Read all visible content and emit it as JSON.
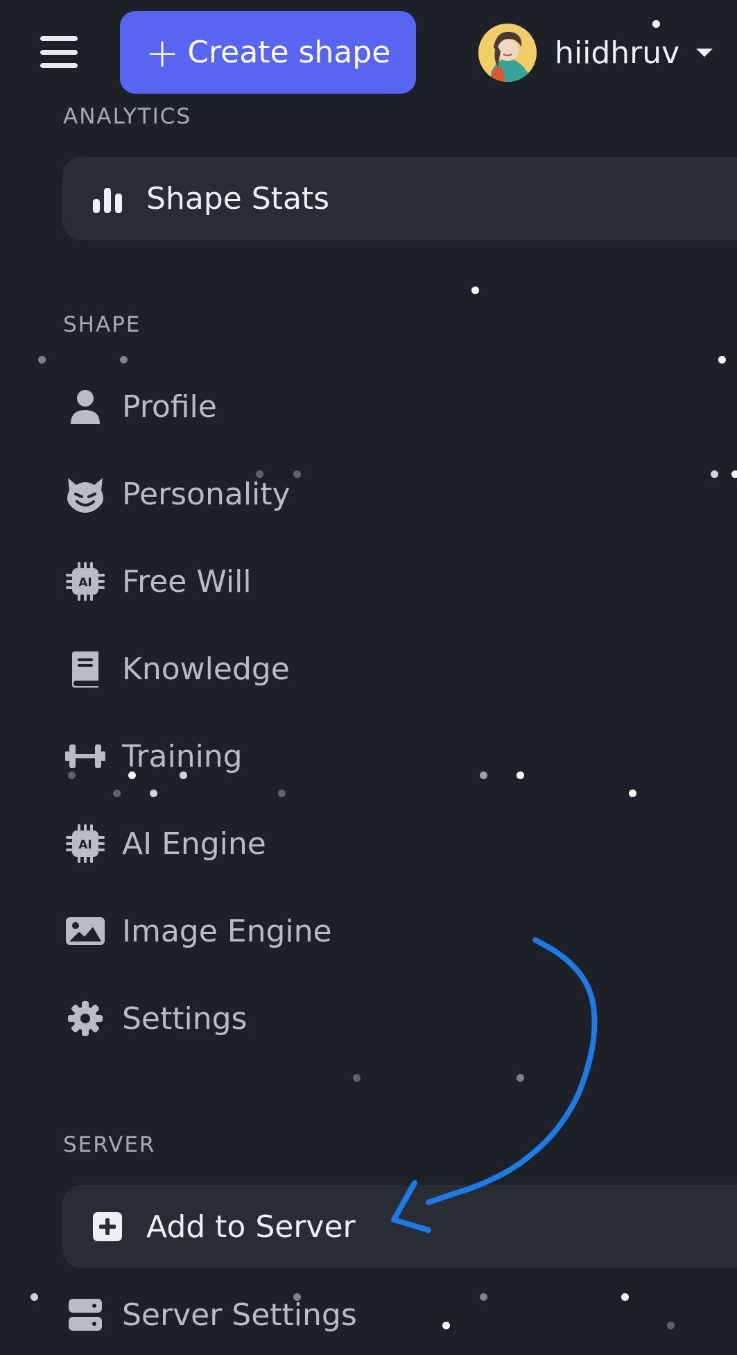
{
  "header": {
    "create_button": {
      "plus": "+",
      "label": "Create shape"
    },
    "user": {
      "name": "hiidhruv"
    }
  },
  "sections": {
    "analytics": {
      "title": "ANALYTICS",
      "items": [
        {
          "label": "Shape Stats",
          "icon": "bar-chart-icon"
        }
      ]
    },
    "shape": {
      "title": "SHAPE",
      "items": [
        {
          "label": "Profile",
          "icon": "user-icon"
        },
        {
          "label": "Personality",
          "icon": "devil-face-icon"
        },
        {
          "label": "Free Will",
          "icon": "ai-chip-icon"
        },
        {
          "label": "Knowledge",
          "icon": "book-icon"
        },
        {
          "label": "Training",
          "icon": "dumbbell-icon"
        },
        {
          "label": "AI Engine",
          "icon": "ai-chip-icon"
        },
        {
          "label": "Image Engine",
          "icon": "image-icon"
        },
        {
          "label": "Settings",
          "icon": "gear-icon"
        }
      ]
    },
    "server": {
      "title": "SERVER",
      "items": [
        {
          "label": "Add to Server",
          "icon": "plus-square-icon"
        },
        {
          "label": "Server Settings",
          "icon": "server-icon"
        }
      ]
    }
  },
  "colors": {
    "background": "#1d2026",
    "accent": "#5865f2",
    "highlight_bg": "#282c34",
    "annotation_arrow": "#1e7be6"
  }
}
